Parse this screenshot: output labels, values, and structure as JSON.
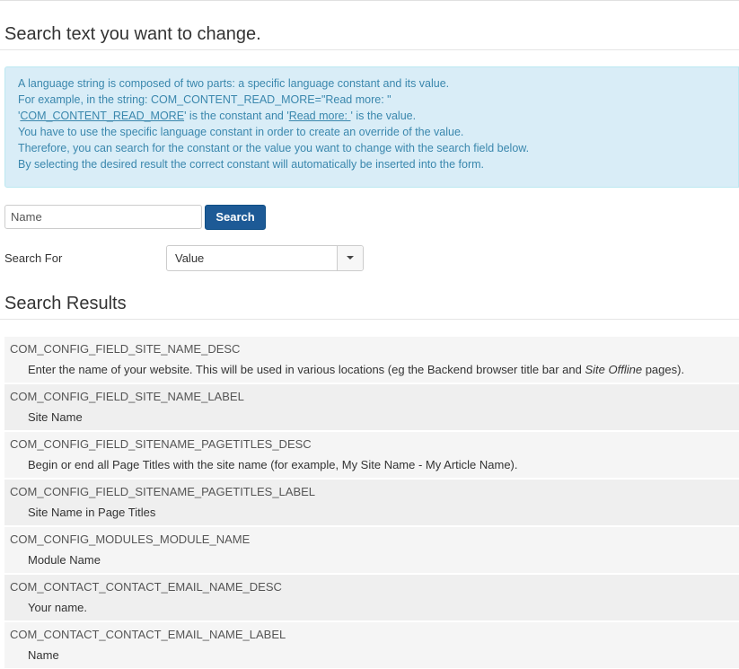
{
  "heading": "Search text you want to change.",
  "info": {
    "line1": "A language string is composed of two parts: a specific language constant and its value.",
    "line2": "For example, in the string: COM_CONTENT_READ_MORE=\"Read more: \"",
    "line3_constant": "COM_CONTENT_READ_MORE",
    "line3_middle": "' is the constant and '",
    "line3_value": "Read more: ",
    "line3_end": "' is the value.",
    "line4": "You have to use the specific language constant in order to create an override of the value.",
    "line5": "Therefore, you can search for the constant or the value you want to change with the search field below.",
    "line6": "By selecting the desired result the correct constant will automatically be inserted into the form."
  },
  "search": {
    "placeholder": "Name",
    "button_label": "Search"
  },
  "search_for": {
    "label": "Search For",
    "selected": "Value"
  },
  "results_heading": "Search Results",
  "results": [
    {
      "constant": "COM_CONFIG_FIELD_SITE_NAME_DESC",
      "value_before": "Enter the name of your website. This will be used in various locations (eg the Backend browser title bar and ",
      "value_italic": "Site Offline",
      "value_after": " pages)."
    },
    {
      "constant": "COM_CONFIG_FIELD_SITE_NAME_LABEL",
      "value": "Site Name"
    },
    {
      "constant": "COM_CONFIG_FIELD_SITENAME_PAGETITLES_DESC",
      "value": "Begin or end all Page Titles with the site name (for example, My Site Name - My Article Name)."
    },
    {
      "constant": "COM_CONFIG_FIELD_SITENAME_PAGETITLES_LABEL",
      "value": "Site Name in Page Titles"
    },
    {
      "constant": "COM_CONFIG_MODULES_MODULE_NAME",
      "value": "Module Name"
    },
    {
      "constant": "COM_CONTACT_CONTACT_EMAIL_NAME_DESC",
      "value": "Your name."
    },
    {
      "constant": "COM_CONTACT_CONTACT_EMAIL_NAME_LABEL",
      "value": "Name"
    }
  ]
}
